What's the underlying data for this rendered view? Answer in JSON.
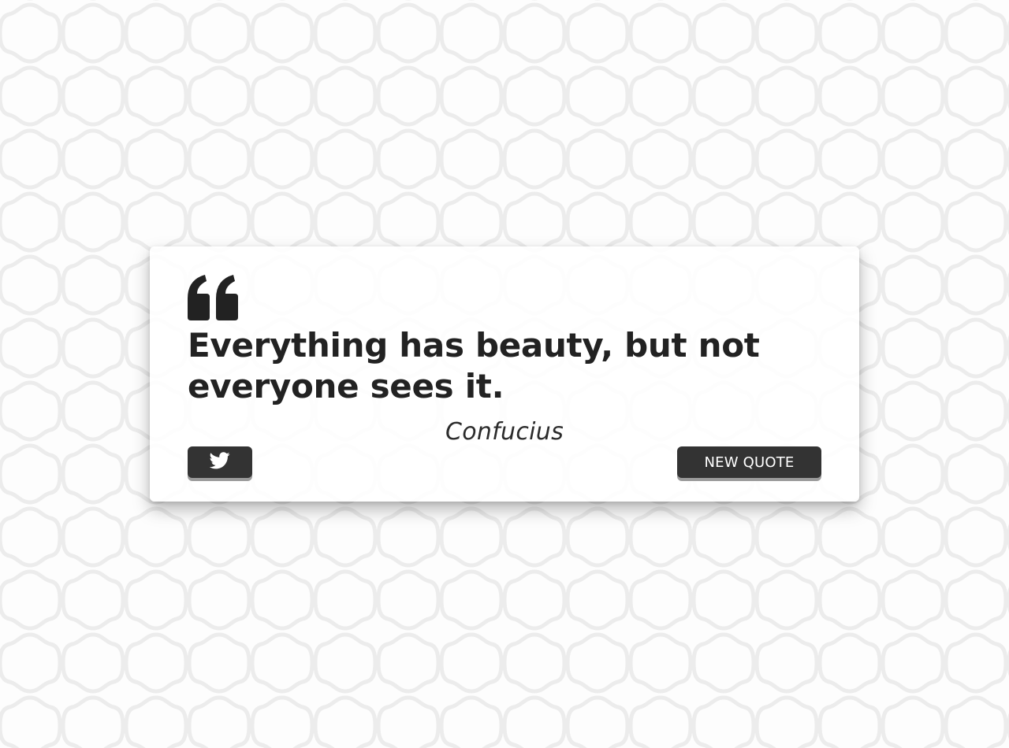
{
  "quote": {
    "text": "Everything has beauty, but not everyone sees it.",
    "author": "Confucius"
  },
  "buttons": {
    "tweet_icon": "twitter-icon",
    "new_quote_label": "NEW QUOTE"
  },
  "colors": {
    "text": "#222222",
    "button_bg": "#333333",
    "button_shadow": "#9a9a9a",
    "card_bg": "#ffffff"
  }
}
